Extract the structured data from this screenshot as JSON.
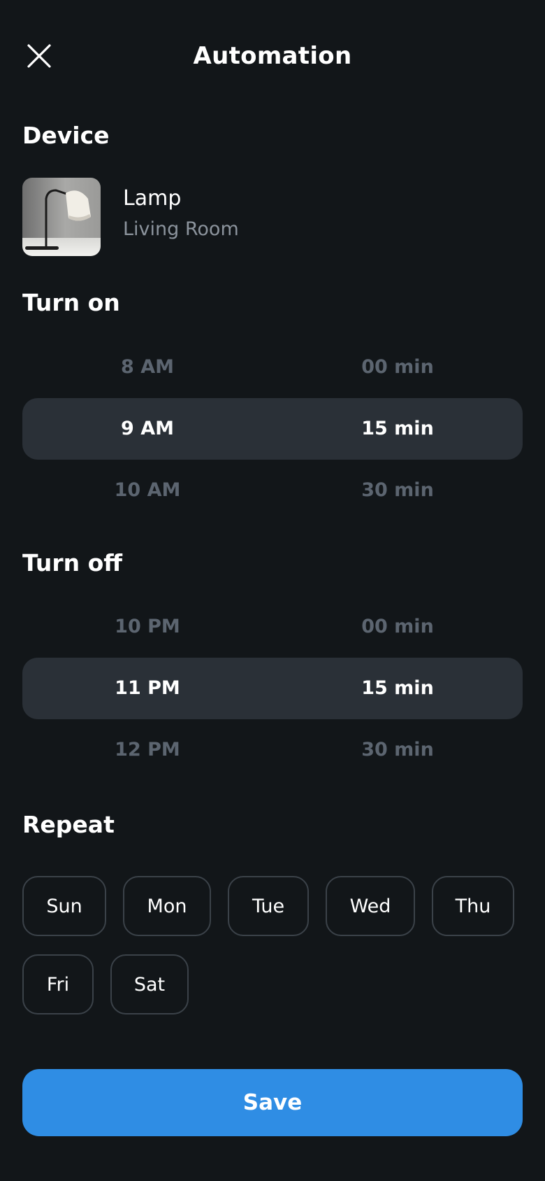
{
  "header": {
    "title": "Automation",
    "close_icon": "close-icon"
  },
  "device": {
    "section_title": "Device",
    "name": "Lamp",
    "room": "Living Room",
    "thumbnail_icon": "lamp-photo"
  },
  "turn_on": {
    "section_title": "Turn on",
    "hours": [
      "8 AM",
      "9 AM",
      "10 AM"
    ],
    "minutes": [
      "00 min",
      "15 min",
      "30 min"
    ],
    "selected_hour": "9 AM",
    "selected_minute": "15 min"
  },
  "turn_off": {
    "section_title": "Turn off",
    "hours": [
      "10 PM",
      "11 PM",
      "12 PM"
    ],
    "minutes": [
      "00 min",
      "15 min",
      "30 min"
    ],
    "selected_hour": "11 PM",
    "selected_minute": "15 min"
  },
  "repeat": {
    "section_title": "Repeat",
    "days": [
      "Sun",
      "Mon",
      "Tue",
      "Wed",
      "Thu",
      "Fri",
      "Sat"
    ]
  },
  "actions": {
    "save_label": "Save"
  },
  "colors": {
    "background": "#121619",
    "picker_highlight": "#2a3037",
    "chip_border": "#3b4249",
    "muted_text": "#5c6570",
    "subtitle_text": "#8c949d",
    "accent": "#2f8de4"
  }
}
